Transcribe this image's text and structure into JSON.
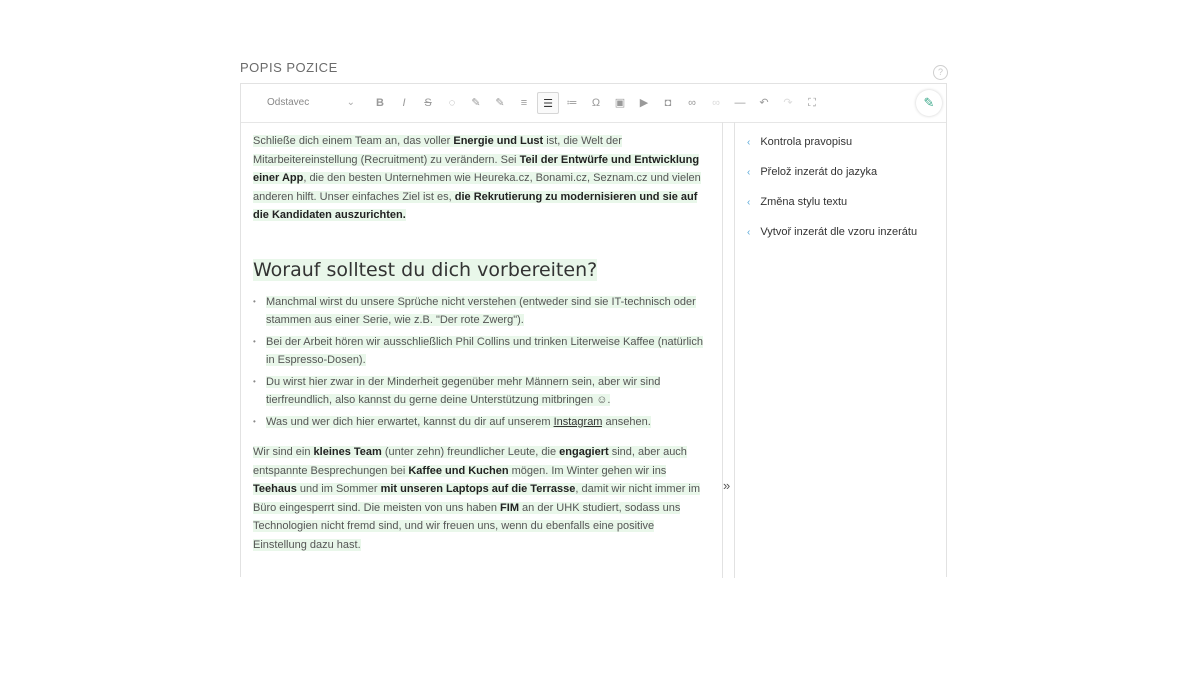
{
  "section": {
    "title": "POPIS POZICE",
    "help_glyph": "?"
  },
  "toolbar": {
    "format_value": "Odstavec",
    "buttons": [
      {
        "icon": "bold-icon",
        "glyph": "B"
      },
      {
        "icon": "italic-icon",
        "glyph": "I"
      },
      {
        "icon": "strikethrough-icon",
        "glyph": "S"
      },
      {
        "icon": "palette-icon",
        "glyph": "◌"
      },
      {
        "icon": "brush-icon",
        "glyph": "✎"
      },
      {
        "icon": "highlighter-icon",
        "glyph": "✎"
      },
      {
        "icon": "align-list-icon",
        "glyph": "≡"
      },
      {
        "icon": "bullet-list-icon",
        "glyph": "☰"
      },
      {
        "icon": "numbered-list-icon",
        "glyph": "≔"
      },
      {
        "icon": "special-char-icon",
        "glyph": "Ω"
      },
      {
        "icon": "image-icon",
        "glyph": "▣"
      },
      {
        "icon": "video-icon",
        "glyph": "▶"
      },
      {
        "icon": "media-icon",
        "glyph": "◘"
      },
      {
        "icon": "link-icon",
        "glyph": "∞"
      },
      {
        "icon": "unlink-icon",
        "glyph": "∞"
      },
      {
        "icon": "horizontal-rule-icon",
        "glyph": "—"
      },
      {
        "icon": "undo-icon",
        "glyph": "↶"
      },
      {
        "icon": "redo-icon",
        "glyph": "↷"
      },
      {
        "icon": "fullscreen-icon",
        "glyph": "⛶"
      }
    ],
    "ai_glyph": "✎"
  },
  "content": {
    "para1": [
      {
        "t": "Schließe dich einem Team an",
        "b": false
      },
      {
        "t": ", das voller ",
        "b": false
      },
      {
        "t": "Energie und Lust",
        "b": true
      },
      {
        "t": " ist, die Welt der Mitarbeitereinstellung (Recruitment) zu verändern. Sei ",
        "b": false
      },
      {
        "t": "Teil der Entwürfe und Entwicklung einer App",
        "b": true
      },
      {
        "t": ", die den besten Unternehmen wie Heureka.cz, Bonami.cz, Seznam.cz und vielen anderen hilft. Unser einfaches Ziel ist es, ",
        "b": false
      },
      {
        "t": "die Rekrutierung zu modernisieren und sie auf die Kandidaten auszurichten.",
        "b": true
      }
    ],
    "heading": "Worauf solltest du dich vorbereiten?",
    "list": [
      "Manchmal wirst du unsere Sprüche nicht verstehen (entweder sind sie IT-technisch oder stammen aus einer Serie, wie z.B. \"Der rote Zwerg\").",
      "Bei der Arbeit hören wir ausschließlich Phil Collins und trinken Literweise Kaffee (natürlich in Espresso-Dosen).",
      "Du wirst hier zwar in der Minderheit gegenüber mehr Männern sein, aber wir sind tierfreundlich, also kannst du gerne deine Unterstützung mitbringen ☺."
    ],
    "list_last_prefix": "Was und wer dich hier erwartet, kannst du dir auf unserem ",
    "list_last_link": "Instagram",
    "list_last_suffix": " ansehen.",
    "para2": [
      {
        "t": "Wir sind ein ",
        "b": false
      },
      {
        "t": "kleines Team",
        "b": true
      },
      {
        "t": " (unter zehn) freundlicher Leute, die ",
        "b": false
      },
      {
        "t": "engagiert",
        "b": true
      },
      {
        "t": " sind, aber auch entspannte Besprechungen bei ",
        "b": false
      },
      {
        "t": "Kaffee und Kuchen",
        "b": true
      },
      {
        "t": " mögen. Im Winter gehen wir ins ",
        "b": false
      },
      {
        "t": "Teehaus",
        "b": true
      },
      {
        "t": " und im Sommer ",
        "b": false
      },
      {
        "t": "mit unseren Laptops auf die Terrasse",
        "b": true
      },
      {
        "t": ", damit wir nicht immer im Büro eingesperrt sind. Die meisten von uns haben ",
        "b": false
      },
      {
        "t": "FIM",
        "b": true
      },
      {
        "t": " an der UHK studiert, sodass uns Technologien nicht fremd sind, und wir freuen uns, wenn du ebenfalls eine positive Einstellung dazu hast.",
        "b": false
      }
    ]
  },
  "collapse_glyph": "»",
  "sidebar": {
    "items": [
      {
        "label": "Kontrola pravopisu"
      },
      {
        "label": "Přelož inzerát do jazyka"
      },
      {
        "label": "Změna stylu textu"
      },
      {
        "label": "Vytvoř inzerát dle vzoru inzerátu"
      }
    ],
    "arrow_glyph": "‹"
  },
  "colors": {
    "highlight": "#e9f7ea",
    "accent": "#3aa88a",
    "arrow": "#5aa8d8"
  }
}
